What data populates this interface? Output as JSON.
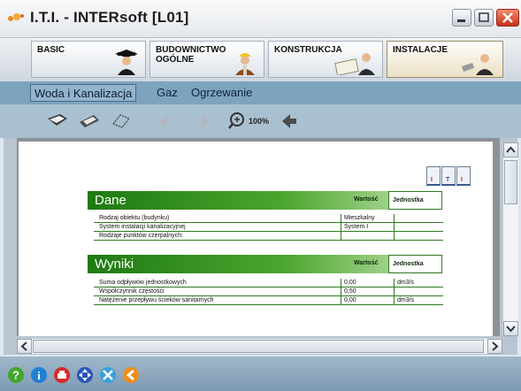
{
  "window": {
    "title": "I.T.I. - INTERsoft [L01]"
  },
  "modules": [
    {
      "label": "BASIC",
      "active": false,
      "icon": "graduate-icon"
    },
    {
      "label": "BUDOWNICTWO\nOGÓLNE",
      "active": false,
      "icon": "builder-icon"
    },
    {
      "label": "KONSTRUKCJA",
      "active": false,
      "icon": "engineer-icon"
    },
    {
      "label": "INSTALACJE",
      "active": true,
      "icon": "plumber-icon"
    }
  ],
  "submenu": [
    {
      "label": "Woda i Kanalizacja",
      "active": true
    },
    {
      "label": "Gaz",
      "active": false
    },
    {
      "label": "Ogrzewanie",
      "active": false
    }
  ],
  "toolbar": {
    "icons": [
      "open-icon",
      "save-icon",
      "print-settings-icon",
      "prev-icon",
      "next-icon",
      "zoom-icon",
      "back-icon"
    ],
    "zoom": "100%"
  },
  "document": {
    "dane": {
      "title": "Dane",
      "col_value": "Wartość",
      "col_unit": "Jednostka",
      "rows": [
        {
          "label": "Rodzaj obiektu (budynku)",
          "value": "Mieszkalny",
          "unit": ""
        },
        {
          "label": "System instalacji kanalizacyjnej",
          "value": "System I",
          "unit": ""
        },
        {
          "label": "Rodzaje punktów czerpalnych:",
          "value": "",
          "unit": ""
        }
      ]
    },
    "wyniki": {
      "title": "Wyniki",
      "col_value": "Wartość",
      "col_unit": "Jednostka",
      "rows": [
        {
          "label": "Suma odpływów jednostkowych",
          "value": "0,00",
          "unit": "dm3/s"
        },
        {
          "label": "Współczynnik częstości",
          "value": "0,50",
          "unit": ""
        },
        {
          "label": "Natężenie przepływu ścieków sanitarnych",
          "value": "0,00",
          "unit": "dm3/s"
        }
      ]
    },
    "column_markers": [
      "I",
      "T",
      "I"
    ]
  },
  "statusbar": {
    "icons": [
      "help-icon",
      "info-icon",
      "print-icon",
      "navigate-icon",
      "tools-icon",
      "exit-icon"
    ]
  },
  "colors": {
    "accent_green": "#2d7a1f",
    "submenu_bg": "#7ea3bf",
    "toolbar_bg": "#a9c0d1"
  }
}
